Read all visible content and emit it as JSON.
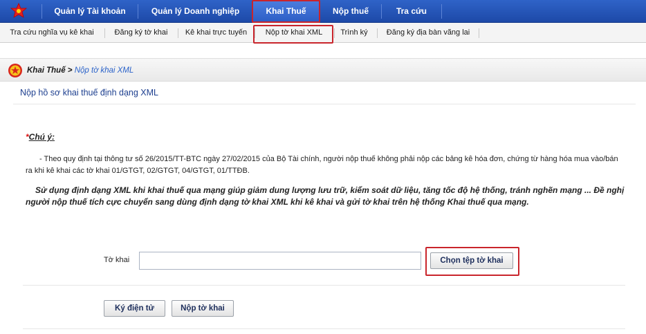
{
  "topnav": {
    "items": [
      "Quản lý Tài khoản",
      "Quản lý Doanh nghiệp",
      "Khai Thuế",
      "Nộp thuế",
      "Tra cứu"
    ],
    "active": "Khai Thuế"
  },
  "subnav": {
    "items": [
      "Tra cứu nghĩa vụ kê khai",
      "Đăng ký tờ khai",
      "Kê khai trực tuyến",
      "Nộp tờ khai XML",
      "Trình ký",
      "Đăng ký địa bàn vãng lai"
    ],
    "active": "Nộp tờ khai XML"
  },
  "breadcrumb": {
    "parent": "Khai Thuế",
    "separator": " > ",
    "current": "Nộp tờ khai XML"
  },
  "page_title": "Nộp hồ sơ khai thuế định dạng XML",
  "note": {
    "star": "*",
    "heading": "Chú ý:",
    "paragraph1": "- Theo quy định tại thông tư số 26/2015/TT-BTC ngày 27/02/2015 của Bộ Tài chính, người nộp thuế không phải nộp các bảng kê hóa đơn, chứng từ hàng hóa mua vào/bán ra khi kê khai các tờ khai 01/GTGT, 02/GTGT, 04/GTGT, 01/TTĐB.",
    "paragraph2": "Sử dụng định dạng XML khi khai thuế qua mạng giúp giảm dung lượng lưu trữ, kiểm soát dữ liệu, tăng tốc độ hệ thống, tránh nghẽn mạng ... Đề nghị người nộp thuế tích cực chuyển sang dùng định dạng tờ khai XML khi kê khai và gửi tờ khai trên hệ thống Khai thuế qua mạng."
  },
  "form": {
    "field_label": "Tờ khai",
    "file_value": "",
    "choose_button": "Chọn tệp tờ khai",
    "sign_button": "Ký điện tử",
    "submit_button": "Nộp tờ khai"
  },
  "colors": {
    "nav_blue": "#1d49a8",
    "highlight_red": "#c9242b",
    "title_blue": "#1d3f8f"
  }
}
